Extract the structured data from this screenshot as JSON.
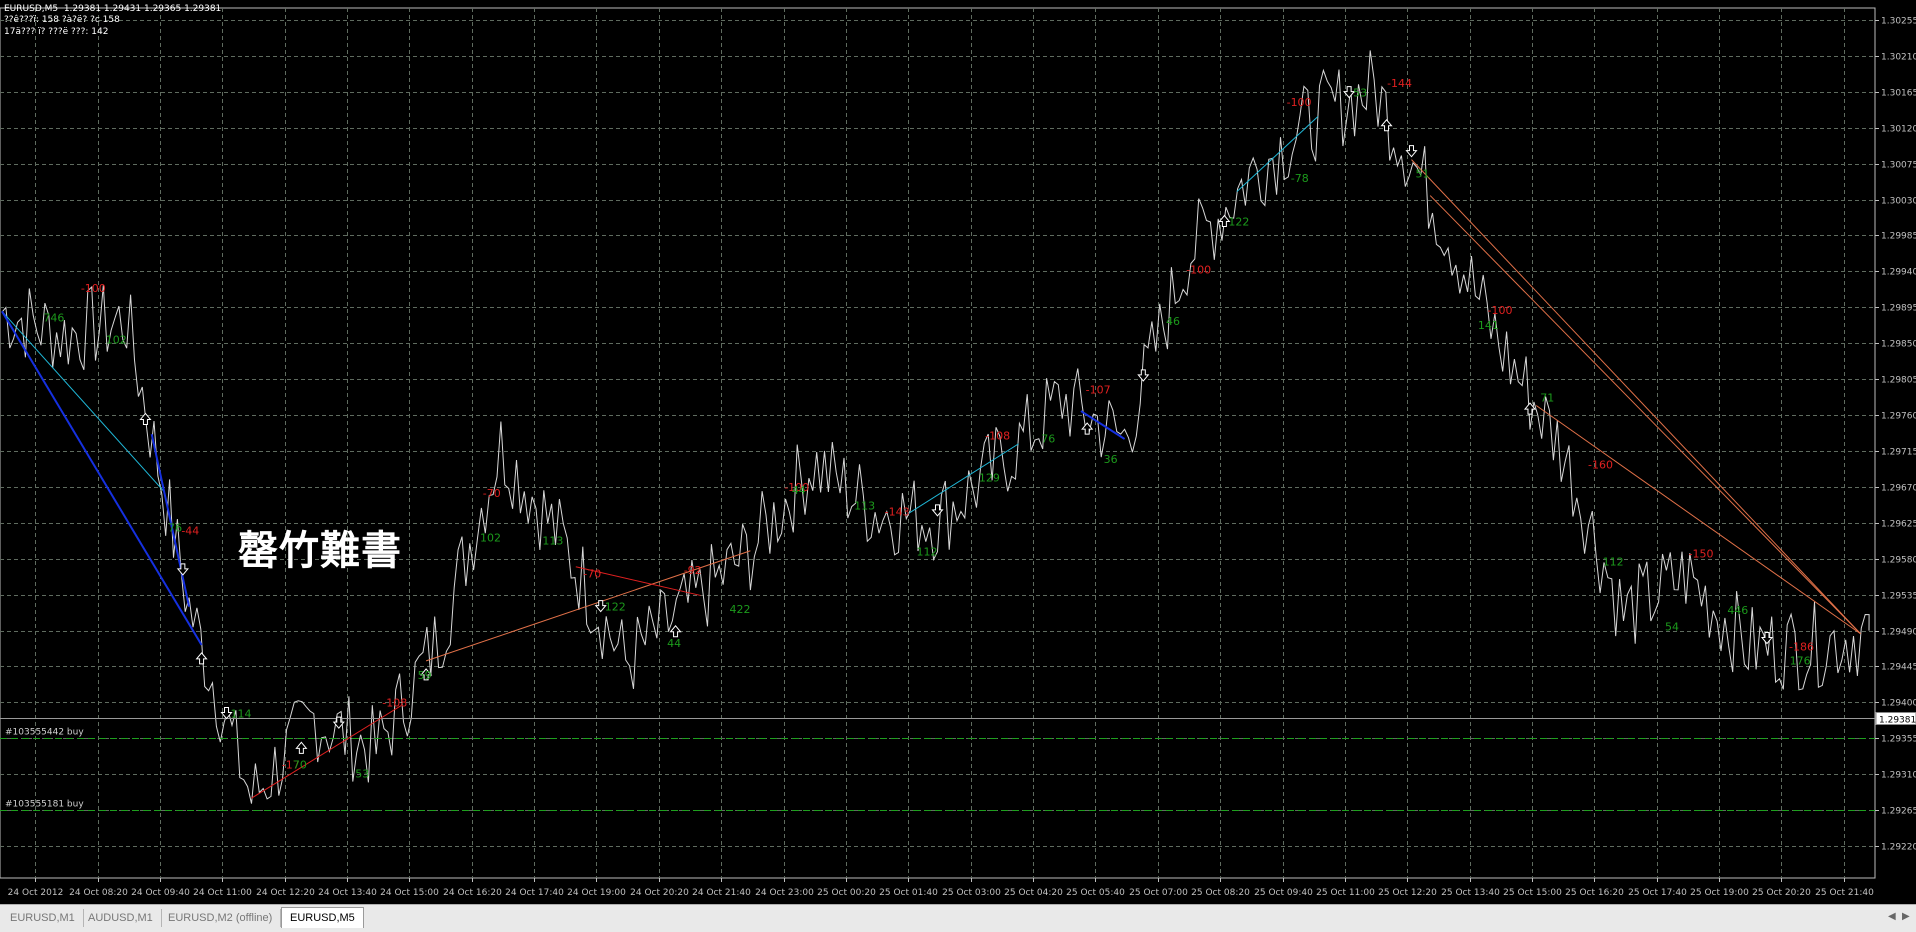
{
  "header": {
    "line1": "EURUSD,M5  1.29381 1.29431 1.29365 1.29381",
    "line2": "??ê???ï: 158 ?à?ë? ?c 158",
    "line3": "17ä??? ï? ???ë ???: 142"
  },
  "watermark": "罄竹難書",
  "colors": {
    "background": "#000000",
    "grid": "#5f6b5f",
    "price_line": "#d8d8d8",
    "axis": "#c0c0c0",
    "label_red": "#e02020",
    "label_green": "#1c9a1c",
    "line_cyan": "#1fb8d8",
    "line_blue": "#1530e0",
    "line_red": "#e02020",
    "line_orange": "#e07048"
  },
  "order_lines": [
    {
      "label": "#103555442 buy",
      "price": 1.29356
    },
    {
      "label": "#103555181 buy",
      "price": 1.29265
    }
  ],
  "current_price": "1.29381",
  "chart_data": {
    "type": "line",
    "symbol": "EURUSD",
    "timeframe": "M5",
    "ylim": [
      1.2918,
      1.3027
    ],
    "y_ticks": [
      "1.30255",
      "1.30210",
      "1.30165",
      "1.30120",
      "1.30075",
      "1.30030",
      "1.29985",
      "1.29940",
      "1.29895",
      "1.29850",
      "1.29805",
      "1.29760",
      "1.29715",
      "1.29670",
      "1.29625",
      "1.29580",
      "1.29535",
      "1.29490",
      "1.29445",
      "1.29400",
      "1.29355",
      "1.29310",
      "1.29265",
      "1.29220"
    ],
    "x_ticks": [
      "24 Oct 2012",
      "24 Oct 08:20",
      "24 Oct 09:40",
      "24 Oct 11:00",
      "24 Oct 12:20",
      "24 Oct 13:40",
      "24 Oct 15:00",
      "24 Oct 16:20",
      "24 Oct 17:40",
      "24 Oct 19:00",
      "24 Oct 20:20",
      "24 Oct 21:40",
      "24 Oct 23:00",
      "25 Oct 00:20",
      "25 Oct 01:40",
      "25 Oct 03:00",
      "25 Oct 04:20",
      "25 Oct 05:40",
      "25 Oct 07:00",
      "25 Oct 08:20",
      "25 Oct 09:40",
      "25 Oct 11:00",
      "25 Oct 12:20",
      "25 Oct 13:40",
      "25 Oct 15:00",
      "25 Oct 16:20",
      "25 Oct 17:40",
      "25 Oct 19:00",
      "25 Oct 20:20",
      "25 Oct 21:40"
    ],
    "series": [
      {
        "name": "",
        "close_by_tick": [
          1.2989,
          1.2986,
          1.2988,
          1.2952,
          1.2928,
          1.2938,
          1.2934,
          1.2948,
          1.2972,
          1.296,
          1.2945,
          1.2952,
          1.2959,
          1.297,
          1.2964,
          1.2963,
          1.297,
          1.2978,
          1.2973,
          1.2996,
          1.3006,
          1.3013,
          1.3017,
          1.3002,
          1.2985,
          1.2972,
          1.2951,
          1.2956,
          1.2947,
          1.2947,
          1.2949
        ]
      }
    ],
    "annotations_red": [
      "-100",
      "-44",
      "-17",
      "-108",
      "-70",
      "-70",
      "-92",
      "-100",
      "-143",
      "-108",
      "-107",
      "-100",
      "-100",
      "-144",
      "-100",
      "-160",
      "-150",
      "-186"
    ],
    "annotations_green": [
      "746",
      "102",
      "76",
      "114",
      "70",
      "53",
      "59",
      "102",
      "113",
      "122",
      "44",
      "422",
      "44",
      "113",
      "112",
      "129",
      "76",
      "36",
      "46",
      "122",
      "-78",
      "53",
      "51",
      "141",
      "71",
      "112",
      "54",
      "446",
      "176"
    ]
  },
  "tabs": [
    {
      "label": "EURUSD,M1",
      "active": false
    },
    {
      "label": "AUDUSD,M1",
      "active": false
    },
    {
      "label": "EURUSD,M2 (offline)",
      "active": false
    },
    {
      "label": "EURUSD,M5",
      "active": true
    }
  ],
  "nav": {
    "left": "◀",
    "right": "▶"
  }
}
